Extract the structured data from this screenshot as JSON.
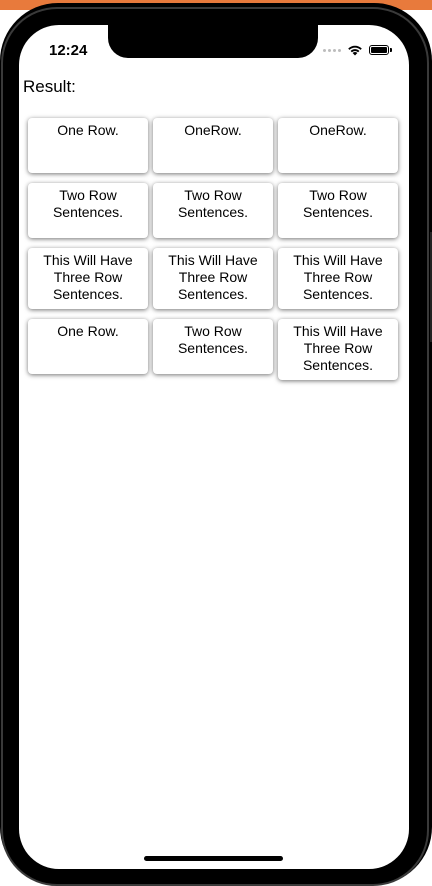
{
  "status_bar": {
    "time": "12:24"
  },
  "result_label": "Result:",
  "grid": {
    "rows": [
      [
        "One Row.",
        "OneRow.",
        "OneRow."
      ],
      [
        "Two Row\nSentences.",
        "Two Row\nSentences.",
        "Two Row\nSentences."
      ],
      [
        "This Will Have\nThree Row\nSentences.",
        "This Will Have\nThree Row\nSentences.",
        "This Will Have\nThree Row\nSentences."
      ],
      [
        "One Row.",
        "Two Row\nSentences.",
        "This Will Have\nThree Row\nSentences."
      ]
    ]
  },
  "icons": {
    "cellular": "signal-dots-icon",
    "wifi": "wifi-icon",
    "battery": "battery-icon"
  },
  "colors": {
    "top_accent": "#e87a3c"
  }
}
